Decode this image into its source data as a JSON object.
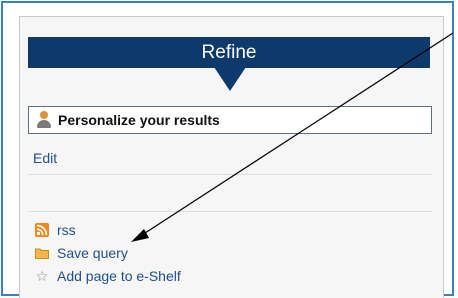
{
  "header": {
    "title": "Refine"
  },
  "personalize": {
    "label": "Personalize your results",
    "icon": "person-icon"
  },
  "edit": {
    "label": "Edit"
  },
  "actions": [
    {
      "label": "rss",
      "icon": "rss-icon"
    },
    {
      "label": "Save query",
      "icon": "folder-icon"
    },
    {
      "label": "Add page to e-Shelf",
      "icon": "star-icon"
    }
  ],
  "colors": {
    "header_bg": "#0d3a6b",
    "frame_border": "#3f7fbf",
    "link": "#1f4e8c",
    "rss": "#ef8a1f",
    "folder": "#f2b64a"
  }
}
